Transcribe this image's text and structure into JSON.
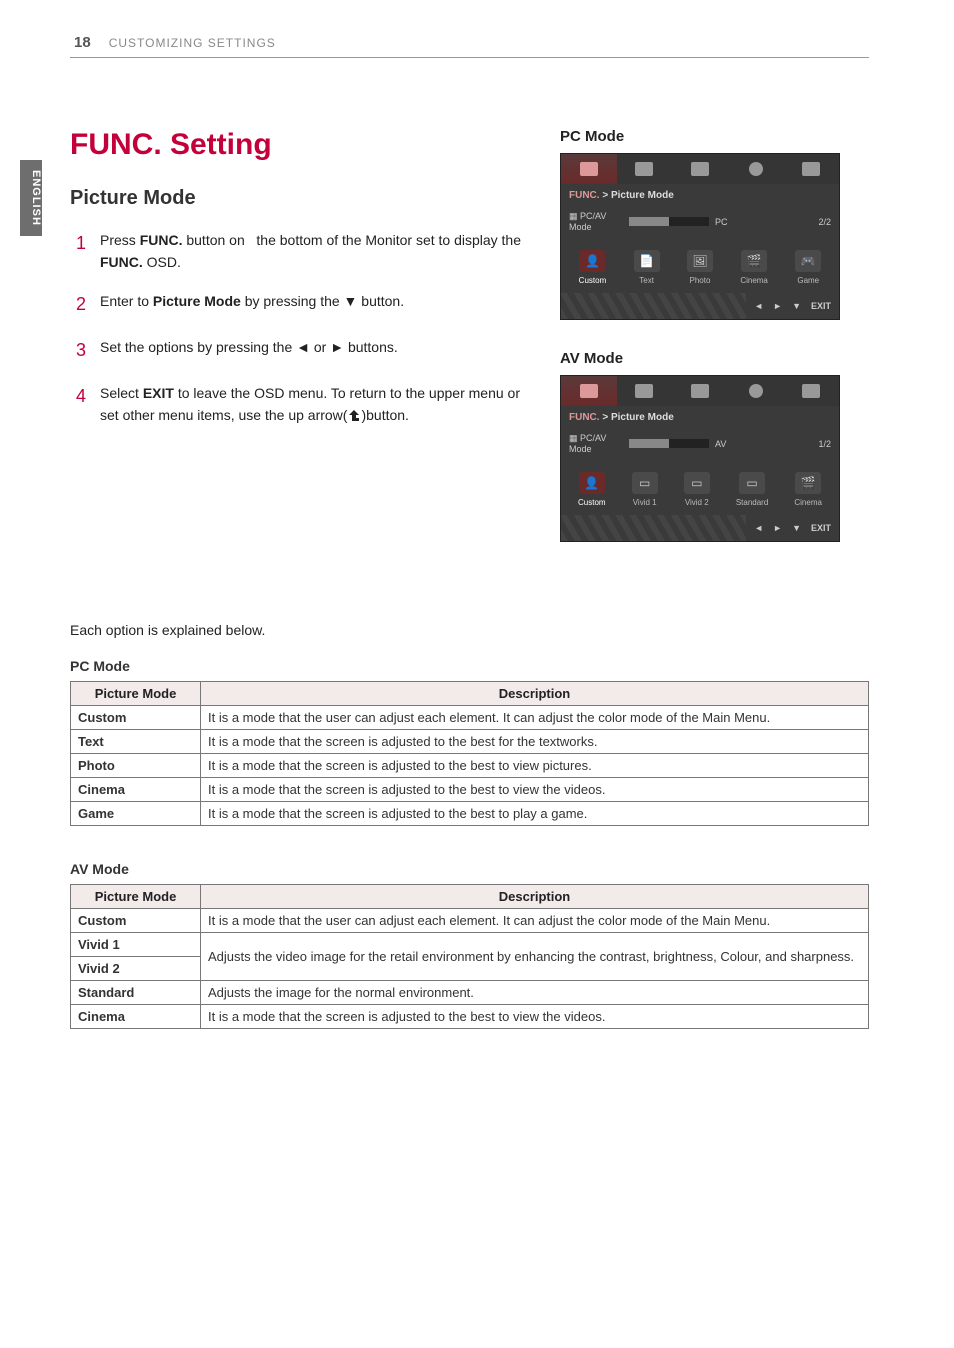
{
  "header": {
    "page_number": "18",
    "section": "CUSTOMIZING SETTINGS"
  },
  "side_tab": "ENGLISH",
  "title": "FUNC. Setting",
  "subtitle": "Picture Mode",
  "steps": [
    {
      "num": "1",
      "html": "Press <b>FUNC.</b> button on   the bottom of the Monitor set to display the <b>FUNC.</b> OSD."
    },
    {
      "num": "2",
      "html": "Enter to <b>Picture Mode</b> by pressing the ▼ button."
    },
    {
      "num": "3",
      "html": "Set the options by pressing the ◄ or ► buttons."
    },
    {
      "num": "4",
      "html": "Select <b>EXIT</b> to leave the OSD menu. To return to the upper menu or set other menu items, use the up arrow(<svg class='up-icon' width='14' height='12' viewBox='0 0 14 12'><path d='M5 11 L5 5 L2 5 L7 0 L12 5 L9 5 L9 8 L12 8 L12 11 Z' fill='#222'/></svg>)button."
    }
  ],
  "osd_pc": {
    "heading": "PC Mode",
    "breadcrumb_main": "FUNC.",
    "breadcrumb_sep": ">",
    "breadcrumb_sub": "Picture Mode",
    "row_label": "PC/AV Mode",
    "bar_value": "PC",
    "paging": "2/2",
    "items": [
      {
        "icon": "👤",
        "label": "Custom",
        "name": "osd-pc-item-custom",
        "active": true
      },
      {
        "icon": "📄",
        "label": "Text",
        "name": "osd-pc-item-text"
      },
      {
        "icon": "🖼",
        "label": "Photo",
        "name": "osd-pc-item-photo"
      },
      {
        "icon": "🎬",
        "label": "Cinema",
        "name": "osd-pc-item-cinema"
      },
      {
        "icon": "🎮",
        "label": "Game",
        "name": "osd-pc-item-game"
      }
    ],
    "exit": "EXIT"
  },
  "osd_av": {
    "heading": "AV Mode",
    "breadcrumb_main": "FUNC.",
    "breadcrumb_sep": ">",
    "breadcrumb_sub": "Picture Mode",
    "row_label": "PC/AV Mode",
    "bar_value": "AV",
    "paging": "1/2",
    "items": [
      {
        "icon": "👤",
        "label": "Custom",
        "name": "osd-av-item-custom",
        "active": true
      },
      {
        "icon": "▭",
        "label": "Vivid 1",
        "name": "osd-av-item-vivid1"
      },
      {
        "icon": "▭",
        "label": "Vivid 2",
        "name": "osd-av-item-vivid2"
      },
      {
        "icon": "▭",
        "label": "Standard",
        "name": "osd-av-item-standard"
      },
      {
        "icon": "🎬",
        "label": "Cinema",
        "name": "osd-av-item-cinema"
      }
    ],
    "exit": "EXIT"
  },
  "explain_text": "Each option is explained below.",
  "table_pc": {
    "title": "PC Mode",
    "head_mode": "Picture Mode",
    "head_desc": "Description",
    "rows": [
      {
        "mode": "Custom",
        "desc": "It is a mode that the user can adjust each element. It can adjust the color mode of the Main Menu."
      },
      {
        "mode": "Text",
        "desc": "It is a mode that the screen is adjusted to the best for the textworks."
      },
      {
        "mode": "Photo",
        "desc": "It is a mode that the screen is adjusted to the best to view pictures."
      },
      {
        "mode": "Cinema",
        "desc": "It is a mode that the screen is adjusted to the best to view the videos."
      },
      {
        "mode": "Game",
        "desc": "It is a mode that the screen is adjusted to the best to play a game."
      }
    ]
  },
  "table_av": {
    "title": "AV Mode",
    "head_mode": "Picture Mode",
    "head_desc": "Description",
    "rows": [
      {
        "mode": "Custom",
        "desc": "It is a mode that the user can adjust each element. It can adjust the color mode of the Main Menu."
      },
      {
        "mode": "Vivid 1",
        "desc": "Adjusts the video image for the retail environment by enhancing the contrast, brightness, Colour, and sharpness.",
        "rowspan": 2
      },
      {
        "mode": "Vivid 2",
        "desc": null
      },
      {
        "mode": "Standard",
        "desc": "Adjusts the image for the normal environment."
      },
      {
        "mode": "Cinema",
        "desc": "It is a mode that the screen is adjusted to the best to view the videos."
      }
    ]
  }
}
